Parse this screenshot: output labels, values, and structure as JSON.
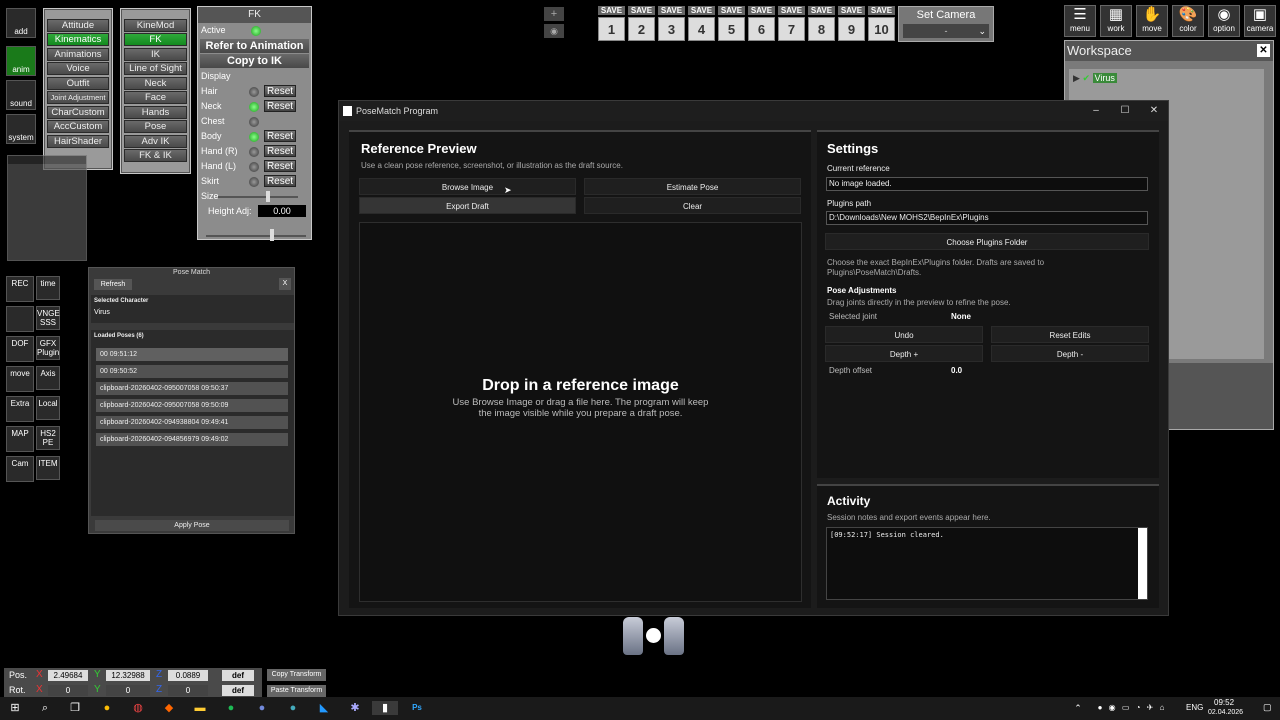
{
  "left_menu": [
    "Attitude",
    "Kinematics",
    "Animations",
    "Voice",
    "Outfit",
    "Joint Adjustment",
    "CharCustom",
    "AccCustom",
    "HairShader"
  ],
  "left_menu_active": 1,
  "kine_menu": [
    "KineMod",
    "FK",
    "IK",
    "Line of Sight",
    "Neck",
    "Face",
    "Hands",
    "Pose",
    "Adv IK",
    "FK & IK"
  ],
  "kine_menu_active": 1,
  "fk": {
    "title": "FK",
    "active": "Active",
    "refer": "Refer to Animation",
    "copy": "Copy to IK",
    "display": "Display",
    "rows": [
      {
        "label": "Hair",
        "on": false,
        "reset": "Reset"
      },
      {
        "label": "Neck",
        "on": true,
        "reset": "Reset"
      },
      {
        "label": "Chest",
        "on": false,
        "reset": ""
      },
      {
        "label": "Body",
        "on": true,
        "reset": "Reset"
      },
      {
        "label": "Hand (R)",
        "on": false,
        "reset": "Reset"
      },
      {
        "label": "Hand (L)",
        "on": false,
        "reset": "Reset"
      },
      {
        "label": "Skirt",
        "on": false,
        "reset": "Reset"
      }
    ],
    "size": "Size",
    "height_adj": "Height Adj:",
    "height_val": "0.00"
  },
  "save_slots": {
    "label": "SAVE",
    "numbers": [
      "1",
      "2",
      "3",
      "4",
      "5",
      "6",
      "7",
      "8",
      "9",
      "10"
    ]
  },
  "camera": {
    "title": "Set Camera",
    "value": "-"
  },
  "top_right_icons": [
    {
      "label": "menu",
      "icon": "menu-icon"
    },
    {
      "label": "work",
      "icon": "work-icon"
    },
    {
      "label": "move",
      "icon": "hand-icon"
    },
    {
      "label": "color",
      "icon": "palette-icon"
    },
    {
      "label": "option",
      "icon": "eye-icon"
    },
    {
      "label": "camera",
      "icon": "camera-icon"
    }
  ],
  "workspace": {
    "title": "Workspace",
    "item": "Virus"
  },
  "left_tools": [
    {
      "a": "add"
    },
    {
      "a": "anim"
    },
    {
      "a": "sound"
    },
    {
      "a": "system"
    },
    {
      "a": "REC",
      "b": "time"
    },
    {
      "a": "",
      "b": "VNGE SSS"
    },
    {
      "a": "DOF",
      "b": "GFX Plugin"
    },
    {
      "a": "move",
      "b": "Axis"
    },
    {
      "a": "Extra",
      "b": "Local"
    },
    {
      "a": "MAP",
      "b": "HS2 PE"
    },
    {
      "a": "Cam",
      "b": "ITEM"
    }
  ],
  "pose_match": {
    "title": "Pose Match",
    "refresh": "Refresh",
    "close": "X",
    "selected_label": "Selected Character",
    "selected": "Virus",
    "loaded_label": "Loaded Poses (6)",
    "poses": [
      "00    09:51:12",
      "00    09:50:52",
      "clipboard-20260402-095007058    09:50:37",
      "clipboard-20260402-095007058    09:50:09",
      "clipboard-20260402-094938804    09:49:41",
      "clipboard-20260402-094856979    09:49:02"
    ],
    "apply": "Apply Pose"
  },
  "window": {
    "title": "PoseMatch Program",
    "preview": {
      "title": "Reference Preview",
      "subtitle": "Use a clean pose reference, screenshot, or illustration as the draft source.",
      "buttons": [
        "Browse Image",
        "Estimate Pose",
        "Export Draft",
        "Clear"
      ],
      "drop_title": "Drop in a reference image",
      "drop_line1": "Use Browse Image or drag a file here. The program will keep",
      "drop_line2": "the image visible while you prepare a draft pose."
    },
    "settings": {
      "title": "Settings",
      "current_ref_label": "Current reference",
      "current_ref": "No image loaded.",
      "plugins_label": "Plugins path",
      "plugins": "D:\\Downloads\\New MOHS2\\BepInEx\\Plugins",
      "choose": "Choose Plugins Folder",
      "hint1": "Choose the exact BepInEx\\Plugins folder. Drafts are saved to",
      "hint2": "Plugins\\PoseMatch\\Drafts.",
      "adj_title": "Pose Adjustments",
      "adj_hint": "Drag joints directly in the preview to refine the pose.",
      "selected_joint_label": "Selected joint",
      "selected_joint": "None",
      "undo": "Undo",
      "reset_edits": "Reset Edits",
      "depth_plus": "Depth +",
      "depth_minus": "Depth -",
      "depth_offset_label": "Depth offset",
      "depth_offset": "0.0"
    },
    "activity": {
      "title": "Activity",
      "subtitle": "Session notes and export events appear here.",
      "log": "[09:52:17] Session cleared."
    }
  },
  "transform": {
    "pos_label": "Pos.",
    "rot_label": "Rot.",
    "pos": {
      "x": "2.49684",
      "y": "12.32988",
      "z": "0.0889"
    },
    "rot": {
      "x": "0",
      "y": "0",
      "z": "0"
    },
    "def": "def",
    "copy": "Copy Transform",
    "paste": "Paste Transform"
  },
  "taskbar": {
    "lang": "ENG",
    "time": "09:52",
    "date": "02.04.2026"
  }
}
